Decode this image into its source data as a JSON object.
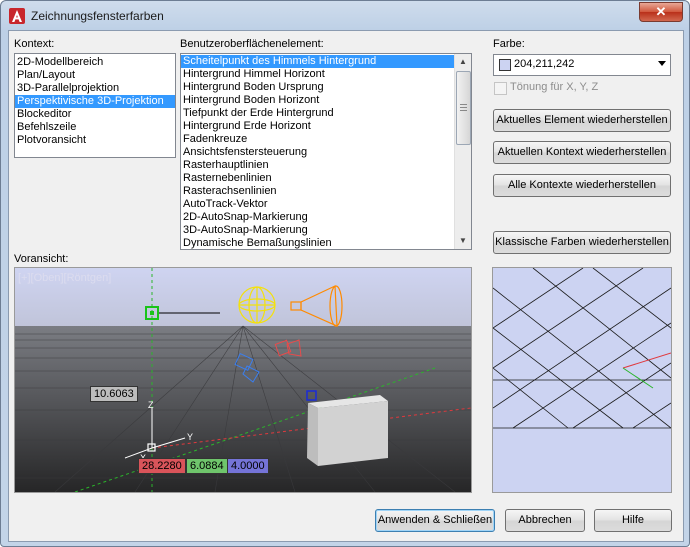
{
  "window": {
    "title": "Zeichnungsfensterfarben",
    "close_glyph": "✕"
  },
  "labels": {
    "context": "Kontext:",
    "ui_element": "Benutzeroberflächenelement:",
    "color": "Farbe:",
    "preview": "Voransicht:"
  },
  "context_items": [
    {
      "label": "2D-Modellbereich"
    },
    {
      "label": "Plan/Layout"
    },
    {
      "label": "3D-Parallelprojektion"
    },
    {
      "label": "Perspektivische 3D-Projektion"
    },
    {
      "label": "Blockeditor"
    },
    {
      "label": "Befehlszeile"
    },
    {
      "label": "Plotvoransicht"
    }
  ],
  "context_selected_index": 3,
  "ui_elements": [
    {
      "label": "Scheitelpunkt des Himmels Hintergrund"
    },
    {
      "label": "Hintergrund Himmel Horizont"
    },
    {
      "label": "Hintergrund Boden Ursprung"
    },
    {
      "label": "Hintergrund Boden Horizont"
    },
    {
      "label": "Tiefpunkt der Erde Hintergrund"
    },
    {
      "label": "Hintergrund Erde Horizont"
    },
    {
      "label": "Fadenkreuze"
    },
    {
      "label": "Ansichtsfenstersteuerung"
    },
    {
      "label": "Rasterhauptlinien"
    },
    {
      "label": "Rasternebenlinien"
    },
    {
      "label": "Rasterachsenlinien"
    },
    {
      "label": "AutoTrack-Vektor"
    },
    {
      "label": "2D-AutoSnap-Markierung"
    },
    {
      "label": "3D-AutoSnap-Markierung"
    },
    {
      "label": "Dynamische Bemaßungslinien"
    }
  ],
  "ui_elements_selected_index": 0,
  "color": {
    "value": "204,211,242",
    "swatch_hex": "#ccd3f2"
  },
  "tint_checkbox": {
    "label": "Tönung für X, Y, Z",
    "checked": false,
    "enabled": false
  },
  "buttons": {
    "restore_element": "Aktuelles Element wiederherstellen",
    "restore_context": "Aktuellen Kontext wiederherstellen",
    "restore_all": "Alle Kontexte wiederherstellen",
    "classic_colors": "Klassische Farben wiederherstellen",
    "apply_close": "Anwenden & Schließen",
    "cancel": "Abbrechen",
    "help": "Hilfe"
  },
  "preview": {
    "viewport_label": "[+][Oben][Röntgen]",
    "dim_distance": "10.6063",
    "coord_x": "28.2280",
    "coord_y": "6.0884",
    "coord_z": "4.0000",
    "axis_x": "X",
    "axis_y": "Y",
    "axis_z": "Z",
    "colors": {
      "coord_x_bg": "#d9545a",
      "coord_y_bg": "#6fc56c",
      "coord_z_bg": "#7574d8"
    }
  }
}
